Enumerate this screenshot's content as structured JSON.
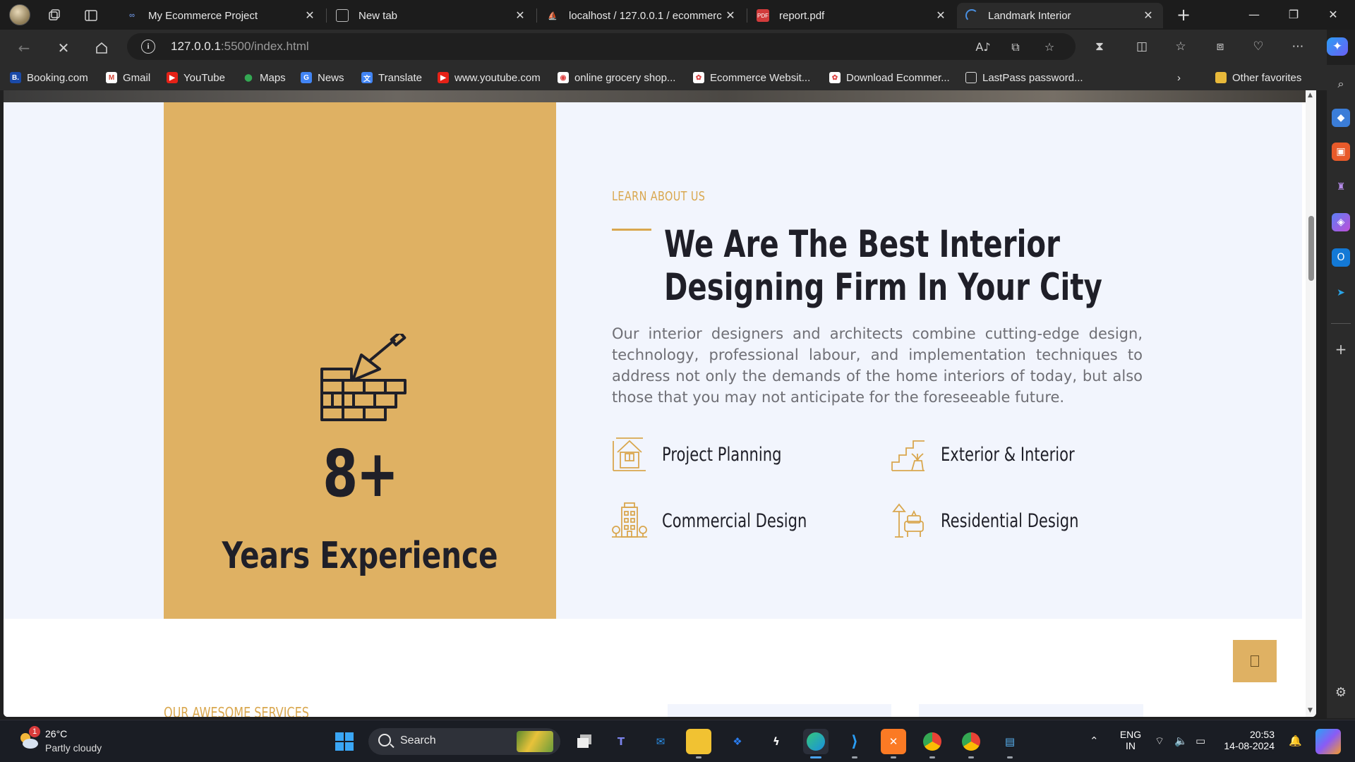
{
  "browser": {
    "tabs": [
      {
        "title": "My Ecommerce Project",
        "icon": "copilot-icon"
      },
      {
        "title": "New tab",
        "icon": "newtab-icon"
      },
      {
        "title": "localhost / 127.0.0.1 / ecommerc",
        "icon": "phpmyadmin-icon"
      },
      {
        "title": "report.pdf",
        "icon": "pdf-icon"
      },
      {
        "title": "Landmark Interior",
        "icon": "loading-icon"
      }
    ],
    "url_host": "127.0.0.1",
    "url_path": ":5500/index.html",
    "bookmarks": [
      "Booking.com",
      "Gmail",
      "YouTube",
      "Maps",
      "News",
      "Translate",
      "www.youtube.com",
      "online grocery shop...",
      "Ecommerce Websit...",
      "Download Ecommer...",
      "LastPass password...",
      "Other favorites"
    ]
  },
  "page": {
    "eyebrow": "LEARN ABOUT US",
    "headline_line1": "We Are The Best Interior",
    "headline_line2": "Designing Firm In Your City",
    "paragraph": "Our interior designers and architects combine cutting-edge design, technology, professional labour, and implementation techniques to address not only the demands of the home interiors of today, but also those that you may not anticipate for the foreseeable future.",
    "experience_number": "8+",
    "experience_label": "Years Experience",
    "features": [
      "Project Planning",
      "Exterior & Interior",
      "Commercial Design",
      "Residential Design"
    ],
    "services_label": "OUR AWESOME SERVICES",
    "accent_color": "#dfb163"
  },
  "taskbar": {
    "temperature": "26°C",
    "weather": "Partly cloudy",
    "weather_badge": "1",
    "search_label": "Search",
    "lang_top": "ENG",
    "lang_bottom": "IN",
    "time": "20:53",
    "date": "14-08-2024"
  }
}
